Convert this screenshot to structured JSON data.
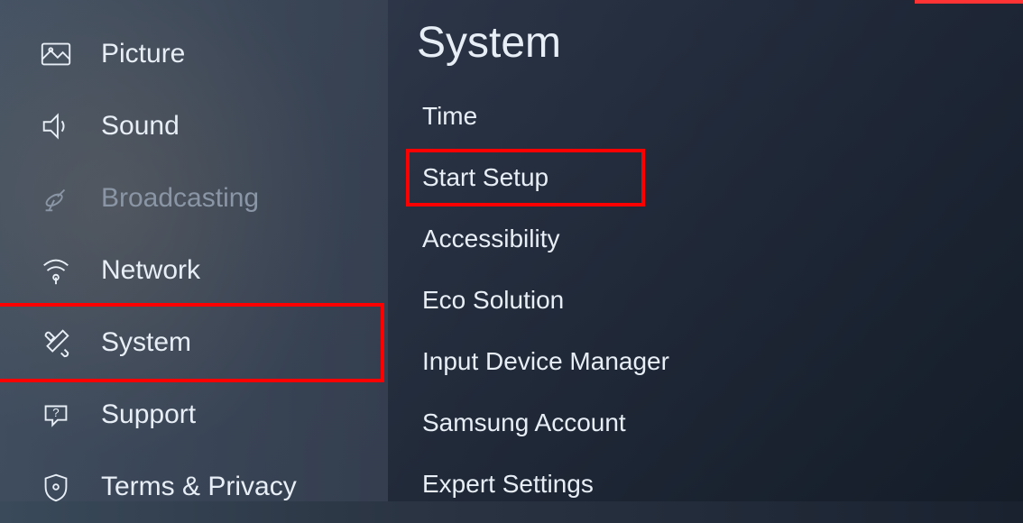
{
  "sidebar": {
    "items": [
      {
        "id": "picture",
        "label": "Picture",
        "disabled": false,
        "highlighted": false
      },
      {
        "id": "sound",
        "label": "Sound",
        "disabled": false,
        "highlighted": false
      },
      {
        "id": "broadcasting",
        "label": "Broadcasting",
        "disabled": true,
        "highlighted": false
      },
      {
        "id": "network",
        "label": "Network",
        "disabled": false,
        "highlighted": false
      },
      {
        "id": "system",
        "label": "System",
        "disabled": false,
        "highlighted": true
      },
      {
        "id": "support",
        "label": "Support",
        "disabled": false,
        "highlighted": false
      },
      {
        "id": "terms-privacy",
        "label": "Terms & Privacy",
        "disabled": false,
        "highlighted": false
      }
    ]
  },
  "main": {
    "title": "System",
    "submenu": [
      {
        "id": "time",
        "label": "Time",
        "highlighted": false
      },
      {
        "id": "start-setup",
        "label": "Start Setup",
        "highlighted": true
      },
      {
        "id": "accessibility",
        "label": "Accessibility",
        "highlighted": false
      },
      {
        "id": "eco-solution",
        "label": "Eco Solution",
        "highlighted": false
      },
      {
        "id": "input-device-manager",
        "label": "Input Device Manager",
        "highlighted": false
      },
      {
        "id": "samsung-account",
        "label": "Samsung Account",
        "highlighted": false
      },
      {
        "id": "expert-settings",
        "label": "Expert Settings",
        "highlighted": false
      }
    ]
  }
}
